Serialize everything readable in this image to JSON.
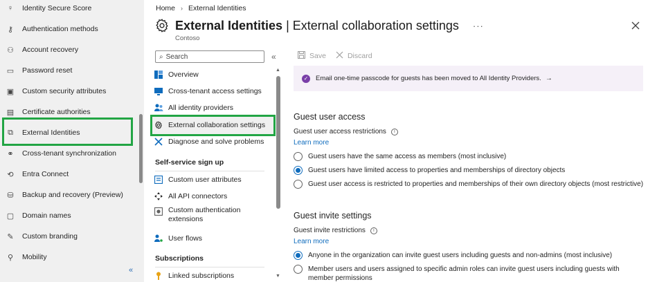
{
  "left_nav": {
    "items": [
      {
        "label": "Identity Secure Score",
        "icon": "trophy-icon",
        "glyph": "♀"
      },
      {
        "label": "Authentication methods",
        "icon": "key-icon",
        "glyph": "⚷"
      },
      {
        "label": "Account recovery",
        "icon": "person-recovery-icon",
        "glyph": "⚇"
      },
      {
        "label": "Password reset",
        "icon": "password-icon",
        "glyph": "▭"
      },
      {
        "label": "Custom security attributes",
        "icon": "attributes-icon",
        "glyph": "▣"
      },
      {
        "label": "Certificate authorities",
        "icon": "certificate-icon",
        "glyph": "▤"
      },
      {
        "label": "External Identities",
        "icon": "external-identities-icon",
        "glyph": "⧉"
      },
      {
        "label": "Cross-tenant synchronization",
        "icon": "sync-icon",
        "glyph": "⚭"
      },
      {
        "label": "Entra Connect",
        "icon": "connect-icon",
        "glyph": "⟲"
      },
      {
        "label": "Backup and recovery (Preview)",
        "icon": "backup-icon",
        "glyph": "⛁"
      },
      {
        "label": "Domain names",
        "icon": "domain-icon",
        "glyph": "▢"
      },
      {
        "label": "Custom branding",
        "icon": "branding-icon",
        "glyph": "✎"
      },
      {
        "label": "Mobility",
        "icon": "mobility-icon",
        "glyph": "⚲"
      }
    ],
    "collapse_glyph": "«"
  },
  "breadcrumb": {
    "home": "Home",
    "current": "External Identities",
    "separator": "›"
  },
  "header": {
    "title_strong": "External Identities",
    "title_rest": "| External collaboration settings",
    "more": "···",
    "subtitle": "Contoso"
  },
  "blade_nav": {
    "search_placeholder": "Search",
    "collapse_glyph": "«",
    "items": [
      {
        "label": "Overview",
        "icon": "overview-icon"
      },
      {
        "label": "Cross-tenant access settings",
        "icon": "cross-tenant-icon"
      },
      {
        "label": "All identity providers",
        "icon": "identity-providers-icon"
      },
      {
        "label": "External collaboration settings",
        "icon": "gear-icon"
      },
      {
        "label": "Diagnose and solve problems",
        "icon": "wrench-icon"
      }
    ],
    "section_self_service": "Self-service sign up",
    "self_service_items": [
      {
        "label": "Custom user attributes",
        "icon": "user-attributes-icon"
      },
      {
        "label": "All API connectors",
        "icon": "api-connectors-icon"
      },
      {
        "label": "Custom authentication extensions",
        "icon": "auth-extensions-icon"
      },
      {
        "label": "User flows",
        "icon": "user-flows-icon"
      }
    ],
    "section_subscriptions": "Subscriptions",
    "subscription_items": [
      {
        "label": "Linked subscriptions",
        "icon": "key-icon"
      }
    ]
  },
  "toolbar": {
    "save": "Save",
    "discard": "Discard"
  },
  "banner": {
    "text": "Email one-time passcode for guests has been moved to All Identity Providers.",
    "arrow": "→"
  },
  "guest_access": {
    "heading": "Guest user access",
    "label": "Guest user access restrictions",
    "learn_more": "Learn more",
    "options": [
      "Guest users have the same access as members (most inclusive)",
      "Guest users have limited access to properties and memberships of directory objects",
      "Guest user access is restricted to properties and memberships of their own directory objects (most restrictive)"
    ],
    "selected_index": 1
  },
  "guest_invite": {
    "heading": "Guest invite settings",
    "label": "Guest invite restrictions",
    "learn_more": "Learn more",
    "options": [
      "Anyone in the organization can invite guest users including guests and non-admins (most inclusive)",
      "Member users and users assigned to specific admin roles can invite guest users including guests with member permissions"
    ],
    "selected_index": 0
  },
  "colors": {
    "accent": "#0f6cbd",
    "highlight": "#22a544",
    "banner_bg": "#f5f0f8",
    "banner_icon": "#7a3fa8"
  }
}
